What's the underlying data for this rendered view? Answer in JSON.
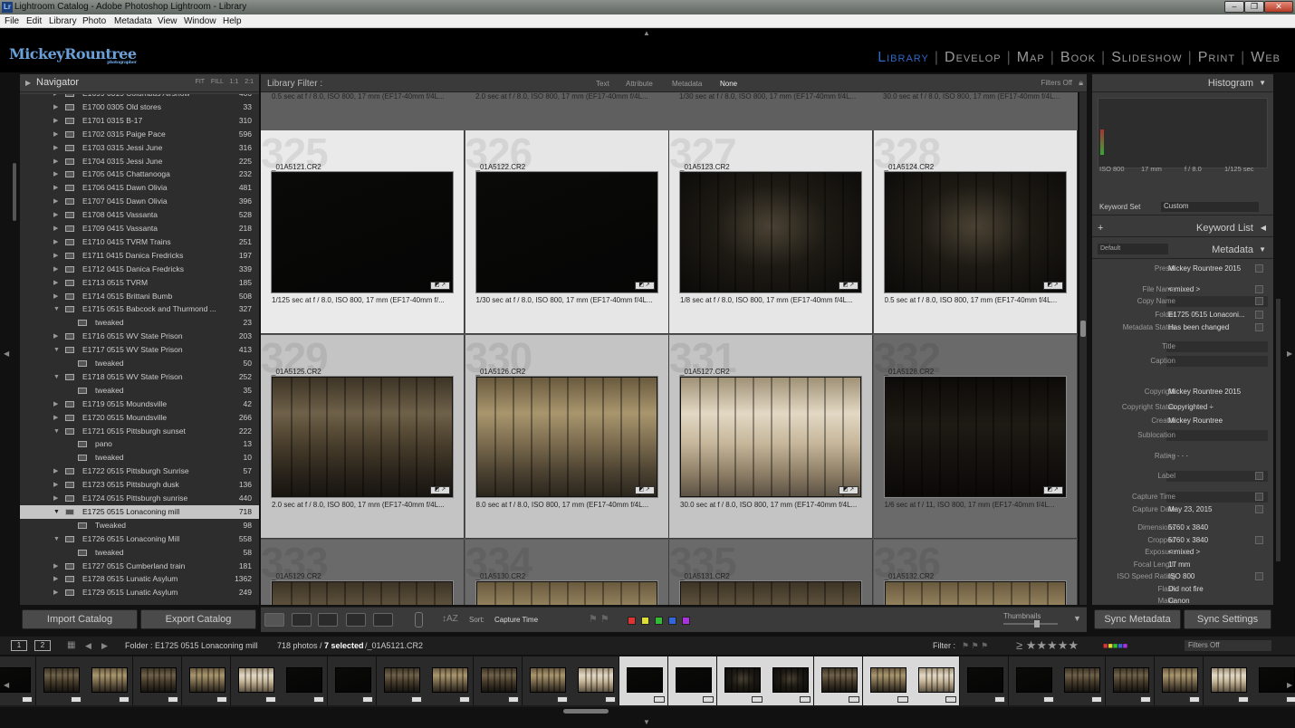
{
  "window": {
    "title": "Lightroom Catalog - Adobe Photoshop Lightroom - Library",
    "icon": "Lr"
  },
  "menu": [
    "File",
    "Edit",
    "Library",
    "Photo",
    "Metadata",
    "View",
    "Window",
    "Help"
  ],
  "identity": {
    "brand": "MickeyRountree",
    "tagline": "photographer"
  },
  "modules": [
    {
      "label": "Library",
      "active": true
    },
    {
      "label": "Develop"
    },
    {
      "label": "Map"
    },
    {
      "label": "Book"
    },
    {
      "label": "Slideshow"
    },
    {
      "label": "Print"
    },
    {
      "label": "Web"
    }
  ],
  "navigator": {
    "title": "Navigator",
    "options": "FIT  FILL  1:1  2:1"
  },
  "folders": [
    {
      "name": "E1699 0315 Columbus Airshow",
      "count": "466",
      "level": 0,
      "exp": false
    },
    {
      "name": "E1700 0305 Old stores",
      "count": "33",
      "level": 0
    },
    {
      "name": "E1701 0315 B-17",
      "count": "310",
      "level": 0
    },
    {
      "name": "E1702 0315 Paige Pace",
      "count": "596",
      "level": 0
    },
    {
      "name": "E1703 0315 Jessi June",
      "count": "316",
      "level": 0
    },
    {
      "name": "E1704 0315 Jessi June",
      "count": "225",
      "level": 0
    },
    {
      "name": "E1705 0415 Chattanooga",
      "count": "232",
      "level": 0
    },
    {
      "name": "E1706 0415 Dawn Olivia",
      "count": "481",
      "level": 0
    },
    {
      "name": "E1707 0415 Dawn Olivia",
      "count": "396",
      "level": 0
    },
    {
      "name": "E1708 0415 Vassanta",
      "count": "528",
      "level": 0
    },
    {
      "name": "E1709 0415 Vassanta",
      "count": "218",
      "level": 0
    },
    {
      "name": "E1710 0415 TVRM Trains",
      "count": "251",
      "level": 0
    },
    {
      "name": "E1711 0415 Danica Fredricks",
      "count": "197",
      "level": 0
    },
    {
      "name": "E1712 0415 Danica Fredricks",
      "count": "339",
      "level": 0
    },
    {
      "name": "E1713 0515 TVRM",
      "count": "185",
      "level": 0
    },
    {
      "name": "E1714 0515 Brittani Bumb",
      "count": "508",
      "level": 0
    },
    {
      "name": "E1715 0515 Babcock and Thurmond ...",
      "count": "327",
      "level": 0,
      "exp": true
    },
    {
      "name": "tweaked",
      "count": "23",
      "level": 1
    },
    {
      "name": "E1716 0515 WV State Prison",
      "count": "203",
      "level": 0
    },
    {
      "name": "E1717 0515 WV State Prison",
      "count": "413",
      "level": 0,
      "exp": true
    },
    {
      "name": "tweaked",
      "count": "50",
      "level": 1
    },
    {
      "name": "E1718 0515 WV State Prison",
      "count": "252",
      "level": 0,
      "exp": true
    },
    {
      "name": "tweaked",
      "count": "35",
      "level": 1
    },
    {
      "name": "E1719 0515 Moundsville",
      "count": "42",
      "level": 0
    },
    {
      "name": "E1720 0515 Moundsville",
      "count": "266",
      "level": 0
    },
    {
      "name": "E1721 0515 Pittsburgh sunset",
      "count": "222",
      "level": 0,
      "exp": true
    },
    {
      "name": "pano",
      "count": "13",
      "level": 1
    },
    {
      "name": "tweaked",
      "count": "10",
      "level": 1
    },
    {
      "name": "E1722 0515 Pittsburgh Sunrise",
      "count": "57",
      "level": 0
    },
    {
      "name": "E1723 0515 Pittsburgh dusk",
      "count": "136",
      "level": 0
    },
    {
      "name": "E1724 0515 Pittsburgh sunrise",
      "count": "440",
      "level": 0
    },
    {
      "name": "E1725 0515 Lonaconing mill",
      "count": "718",
      "level": 0,
      "exp": true,
      "selected": true
    },
    {
      "name": "Tweaked",
      "count": "98",
      "level": 1
    },
    {
      "name": "E1726 0515 Lonaconing Mill",
      "count": "558",
      "level": 0,
      "exp": true
    },
    {
      "name": "tweaked",
      "count": "58",
      "level": 1
    },
    {
      "name": "E1727 0515 Cumberland train",
      "count": "181",
      "level": 0
    },
    {
      "name": "E1728 0515 Lunatic Asylum",
      "count": "1362",
      "level": 0
    },
    {
      "name": "E1729 0515 Lunatic Asylum",
      "count": "249",
      "level": 0
    }
  ],
  "left_buttons": {
    "import": "Import Catalog",
    "export": "Export Catalog"
  },
  "filter_bar": {
    "label": "Library Filter :",
    "items": [
      "Text",
      "Attribute",
      "Metadata",
      "None"
    ],
    "active": "None",
    "status": "Filters Off"
  },
  "grid": {
    "top_exif": [
      "0.5 sec at f / 8.0, ISO 800, 17 mm (EF17-40mm f/4L...",
      "2.0 sec at f / 8.0, ISO 800, 17 mm (EF17-40mm f/4L...",
      "1/30 sec at f / 8.0, ISO 800, 17 mm (EF17-40mm f/4L...",
      "30.0 sec at f / 8.0, ISO 800, 17 mm (EF17-40mm f/4L..."
    ],
    "cells": [
      {
        "idx": "325",
        "file": "_01A5121.CR2",
        "exif": "1/125 sec at f / 8.0, ISO 800, 17 mm (EF17-40mm f/...",
        "img": "dark",
        "selected": true
      },
      {
        "idx": "326",
        "file": "_01A5122.CR2",
        "exif": "1/30 sec at f / 8.0, ISO 800, 17 mm (EF17-40mm f/4L...",
        "img": "dark",
        "selected": true
      },
      {
        "idx": "327",
        "file": "_01A5123.CR2",
        "exif": "1/8 sec at f / 8.0, ISO 800, 17 mm (EF17-40mm f/4L...",
        "img": "dimroom",
        "selected": true
      },
      {
        "idx": "328",
        "file": "_01A5124.CR2",
        "exif": "0.5 sec at f / 8.0, ISO 800, 17 mm (EF17-40mm f/4L...",
        "img": "dimroom",
        "selected": true
      },
      {
        "idx": "329",
        "file": "_01A5125.CR2",
        "exif": "2.0 sec at f / 8.0, ISO 800, 17 mm (EF17-40mm f/4L...",
        "img": "room1",
        "selected": true
      },
      {
        "idx": "330",
        "file": "_01A5126.CR2",
        "exif": "8.0 sec at f / 8.0, ISO 800, 17 mm (EF17-40mm f/4L...",
        "img": "room2",
        "selected": true
      },
      {
        "idx": "331",
        "file": "_01A5127.CR2",
        "exif": "30.0 sec at f / 8.0, ISO 800, 17 mm (EF17-40mm f/4L...",
        "img": "room3",
        "selected": true
      },
      {
        "idx": "332",
        "file": "_01A5128.CR2",
        "exif": "1/6 sec at f / 11, ISO 800, 17 mm (EF17-40mm f/4L...",
        "img": "room4",
        "selected": false
      },
      {
        "idx": "333",
        "file": "_01A5129.CR2",
        "exif": "",
        "img": "room1",
        "selected": false
      },
      {
        "idx": "334",
        "file": "_01A5130.CR2",
        "exif": "",
        "img": "room2",
        "selected": false
      },
      {
        "idx": "335",
        "file": "_01A5131.CR2",
        "exif": "",
        "img": "room1",
        "selected": false
      },
      {
        "idx": "336",
        "file": "_01A5132.CR2",
        "exif": "",
        "img": "room2",
        "selected": false
      }
    ]
  },
  "toolbar": {
    "sort_label": "Sort:",
    "sort_value": "Capture Time",
    "thumbnails": "Thumbnails",
    "colors": [
      "#d33",
      "#dd3",
      "#3b3",
      "#36d",
      "#a3d"
    ]
  },
  "right": {
    "histogram": "Histogram",
    "histo_info": {
      "iso": "ISO 800",
      "focal": "17 mm",
      "aperture": "f / 8.0",
      "shutter": "1/125 sec"
    },
    "keyword_set_label": "Keyword Set",
    "keyword_set_value": "Custom",
    "keyword_list": "Keyword List",
    "metadata_preset_name": "Default",
    "metadata_title": "Metadata",
    "rows": [
      {
        "label": "Preset",
        "value": "Mickey Rountree 2015",
        "sb": true
      },
      {
        "label": "File Name",
        "value": "< mixed >",
        "sb": true
      },
      {
        "label": "Copy Name",
        "value": "",
        "sb": true
      },
      {
        "label": "Folder",
        "value": "E1725 0515 Lonaconi...",
        "sb": true
      },
      {
        "label": "Metadata Status",
        "value": "Has been changed",
        "sb": true
      },
      {
        "label": "Title",
        "value": ""
      },
      {
        "label": "Caption",
        "value": ""
      },
      {
        "label": "Copyright",
        "value": "Mickey Rountree 2015"
      },
      {
        "label": "Copyright Status",
        "value": "Copyrighted ÷"
      },
      {
        "label": "Creator",
        "value": "Mickey Rountree"
      },
      {
        "label": "Sublocation",
        "value": ""
      },
      {
        "label": "Rating",
        "value": "· · · · ·"
      },
      {
        "label": "Label",
        "value": "",
        "sb": true
      },
      {
        "label": "Capture Time",
        "value": "",
        "sb": true
      },
      {
        "label": "Capture Date",
        "value": "May 23, 2015",
        "sb": true
      },
      {
        "label": "Dimensions",
        "value": "5760 x 3840"
      },
      {
        "label": "Cropped",
        "value": "5760 x 3840",
        "sb": true
      },
      {
        "label": "Exposure",
        "value": "< mixed >"
      },
      {
        "label": "Focal Length",
        "value": "17 mm"
      },
      {
        "label": "ISO Speed Rating",
        "value": "ISO 800",
        "sb": true
      },
      {
        "label": "Flash",
        "value": "Did not fire"
      },
      {
        "label": "Make",
        "value": "Canon"
      }
    ],
    "sync_metadata": "Sync Metadata",
    "sync_settings": "Sync Settings"
  },
  "filmbar": {
    "page1": "1",
    "page2": "2",
    "source": "Folder : E1725 0515 Lonaconing mill",
    "count": "718 photos /",
    "selected": "7 selected",
    "current": "/_01A5121.CR2",
    "filter_label": "Filter :",
    "filters_off": "Filters Off"
  },
  "filmstrip": [
    "dark",
    "room1",
    "room2",
    "room1",
    "room2",
    "room3",
    "dark",
    "dark",
    "room1",
    "room2",
    "room1",
    "room2",
    "room3",
    "dark",
    "dark",
    "dimroom",
    "dimroom",
    "room1",
    "room2",
    "room3",
    "dark",
    "dark",
    "room1",
    "room1",
    "room2",
    "room3",
    "dark",
    "dark"
  ],
  "film_selected": [
    13,
    14,
    15,
    16,
    17,
    18,
    19
  ]
}
